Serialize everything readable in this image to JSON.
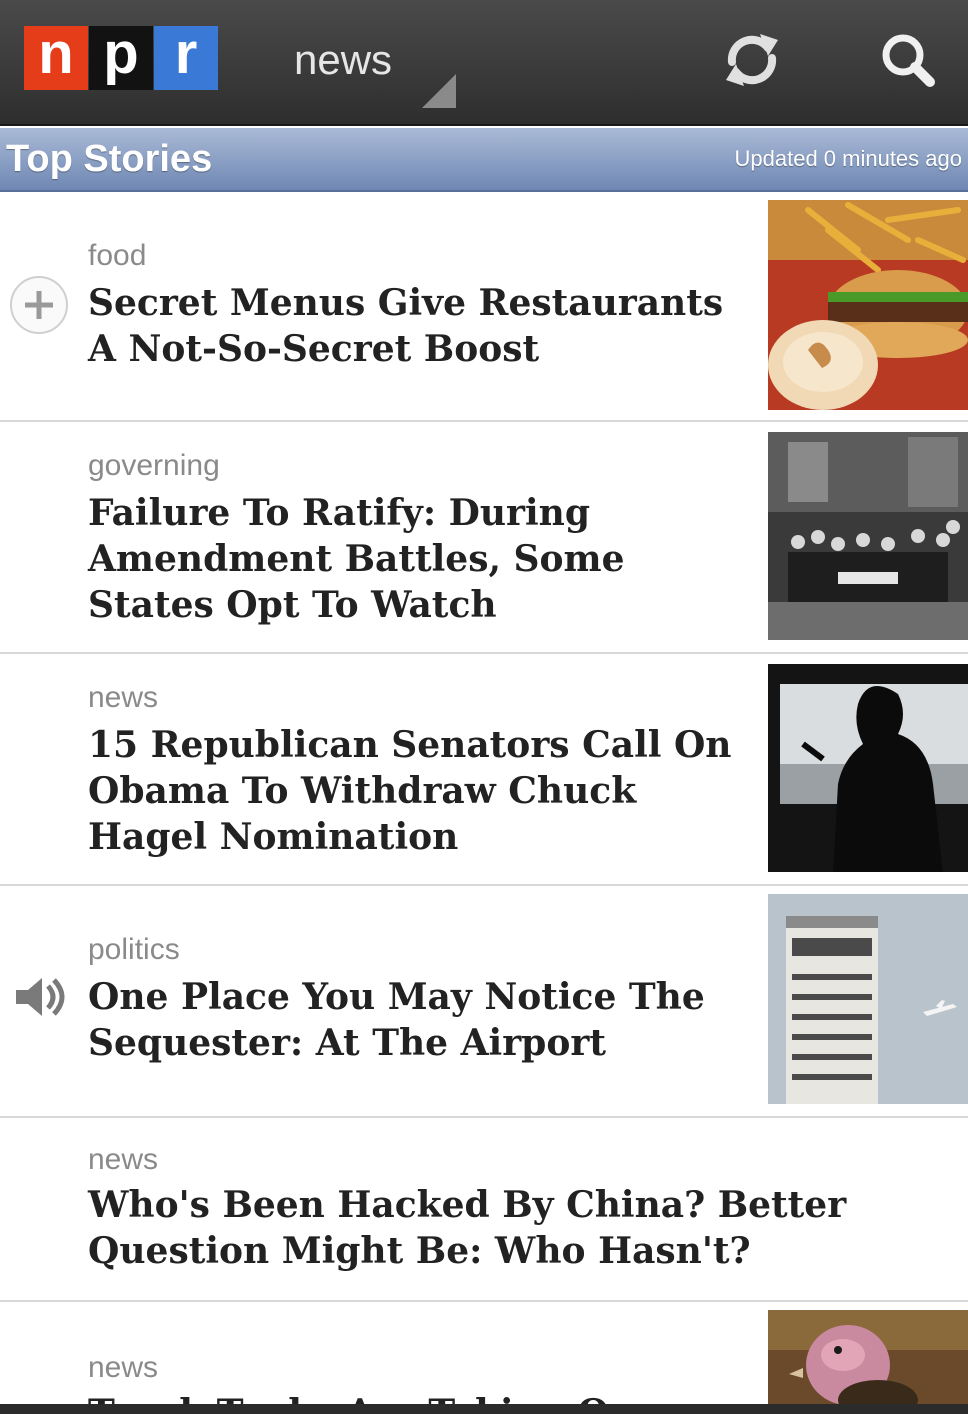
{
  "appbar": {
    "logo_letters": [
      "n",
      "p",
      "r"
    ],
    "section": "news",
    "refresh_icon": "refresh-icon",
    "search_icon": "search-icon"
  },
  "topbar": {
    "title": "Top Stories",
    "updated": "Updated 0 minutes ago"
  },
  "stories": [
    {
      "category": "food",
      "headline": "Secret Menus Give Restaurants A Not-So-Secret Boost",
      "lead_icon": "add-icon",
      "thumb": "burger-and-fries"
    },
    {
      "category": "governing",
      "headline": "Failure To Ratify: During Amendment Battles, Some States Opt To Watch",
      "thumb": "historical-assembly-painting"
    },
    {
      "category": "news",
      "headline": "15 Republican Senators Call On Obama To Withdraw Chuck Hagel Nomination",
      "thumb": "man-silhouette-phone"
    },
    {
      "category": "politics",
      "headline": "One Place You May Notice The Sequester: At The Airport",
      "lead_icon": "speaker-icon",
      "thumb": "control-tower"
    },
    {
      "category": "news",
      "headline": "Who's Been Hacked By China? Better Question Might Be: Who Hasn't?"
    },
    {
      "category": "news",
      "headline": "Truck Tucks Are Taking On...",
      "thumb": "turkey"
    }
  ],
  "colors": {
    "npr_red": "#e53c19",
    "npr_black": "#121212",
    "npr_blue": "#3a7ad6",
    "topbar_blue": "#7f95bd"
  }
}
